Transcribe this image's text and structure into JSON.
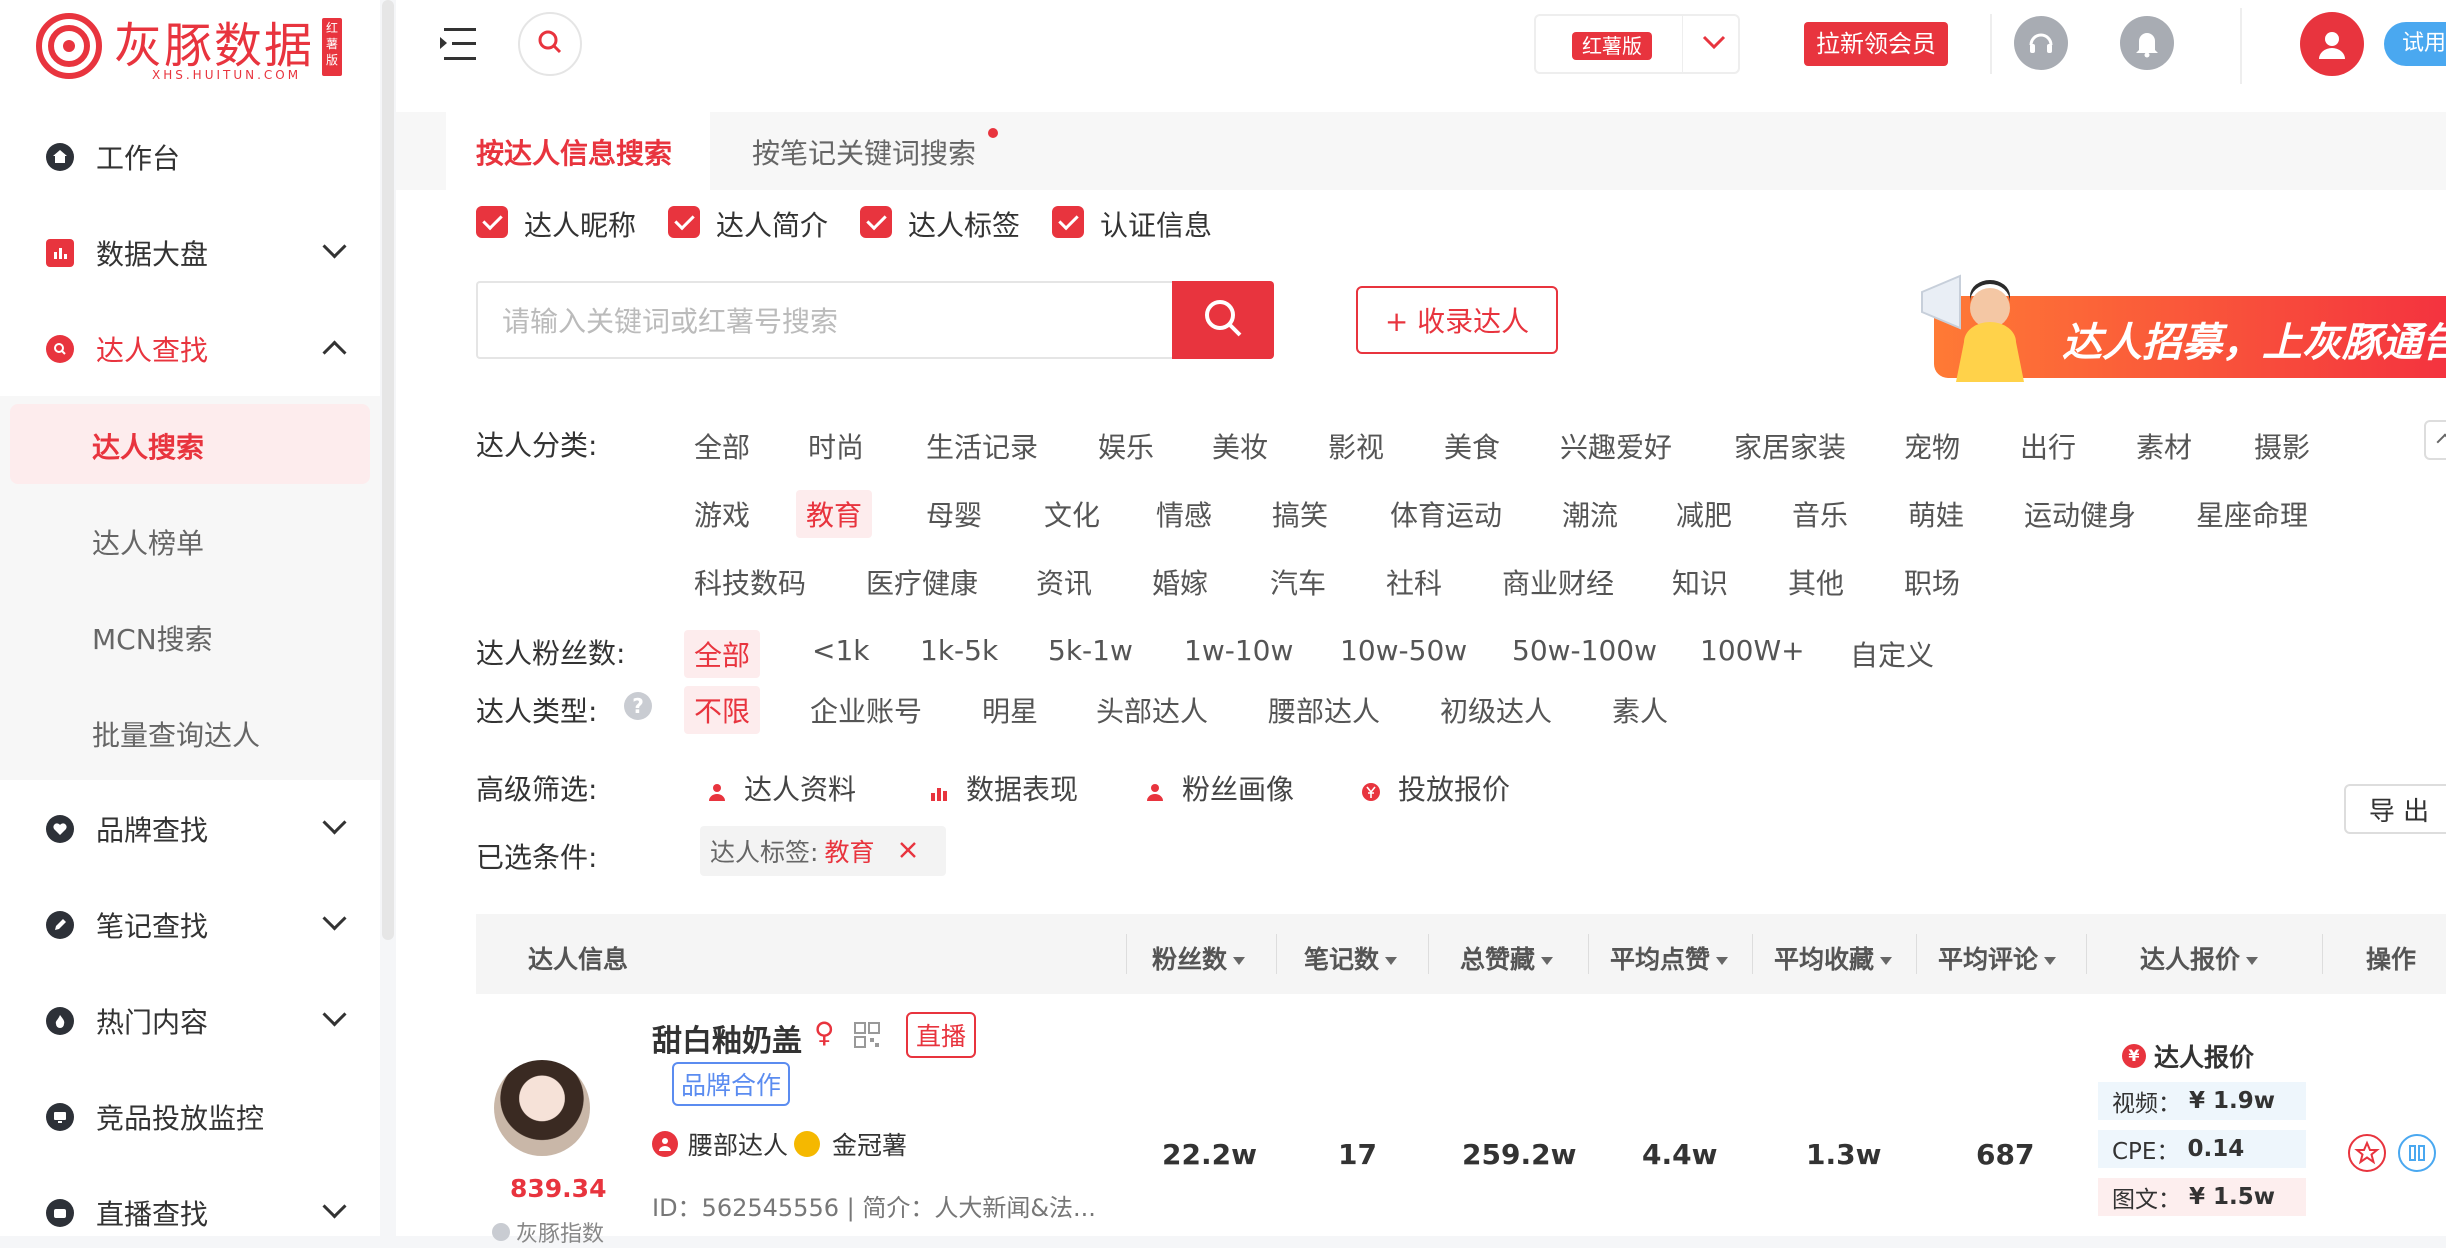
{
  "brand": {
    "name": "灰豚数据",
    "domain_text": "XHS.HUITUN.COM",
    "edition_badge": "红薯版",
    "accent": "#e8343e"
  },
  "sidebar": {
    "items": [
      {
        "label": "工作台",
        "icon": "home-icon"
      },
      {
        "label": "数据大盘",
        "icon": "chart-bars-icon",
        "expandable": true
      },
      {
        "label": "达人查找",
        "icon": "search-circle-icon",
        "expanded": true,
        "children": [
          {
            "label": "达人搜索",
            "active": true
          },
          {
            "label": "达人榜单"
          },
          {
            "label": "MCN搜索"
          },
          {
            "label": "批量查询达人"
          }
        ]
      },
      {
        "label": "品牌查找",
        "icon": "heart-icon",
        "expandable": true
      },
      {
        "label": "笔记查找",
        "icon": "pencil-icon",
        "expandable": true
      },
      {
        "label": "热门内容",
        "icon": "fire-icon",
        "expandable": true
      },
      {
        "label": "竞品投放监控",
        "icon": "monitor-icon"
      },
      {
        "label": "直播查找",
        "icon": "live-icon",
        "expandable": true
      }
    ]
  },
  "header": {
    "version_selector": "红薯版",
    "invite_button": "拉新领会员",
    "trial_button": "试用"
  },
  "tabs": [
    {
      "label": "按达人信息搜索",
      "active": true
    },
    {
      "label": "按笔记关键词搜索",
      "active": false,
      "dot": true
    }
  ],
  "search_fields": [
    "达人昵称",
    "达人简介",
    "达人标签",
    "认证信息"
  ],
  "search": {
    "placeholder": "请输入关键词或红薯号搜索",
    "collect_button": "+ 收录达人"
  },
  "banner": {
    "text": "达人招募，上灰豚通告 →"
  },
  "filters": {
    "category": {
      "label": "达人分类:",
      "selected": "教育",
      "rows": [
        [
          "全部",
          "时尚",
          "生活记录",
          "娱乐",
          "美妆",
          "影视",
          "美食",
          "兴趣爱好",
          "家居家装",
          "宠物",
          "出行",
          "素材",
          "摄影"
        ],
        [
          "游戏",
          "教育",
          "母婴",
          "文化",
          "情感",
          "搞笑",
          "体育运动",
          "潮流",
          "减肥",
          "音乐",
          "萌娃",
          "运动健身",
          "星座命理"
        ],
        [
          "科技数码",
          "医疗健康",
          "资讯",
          "婚嫁",
          "汽车",
          "社科",
          "商业财经",
          "知识",
          "其他",
          "职场"
        ]
      ]
    },
    "fans": {
      "label": "达人粉丝数:",
      "selected": "全部",
      "options": [
        "全部",
        "<1k",
        "1k-5k",
        "5k-1w",
        "1w-10w",
        "10w-50w",
        "50w-100w",
        "100W+",
        "自定义"
      ]
    },
    "type": {
      "label": "达人类型:",
      "selected": "不限",
      "options": [
        "不限",
        "企业账号",
        "明星",
        "头部达人",
        "腰部达人",
        "初级达人",
        "素人"
      ]
    },
    "advanced": {
      "label": "高级筛选:",
      "options": [
        "达人资料",
        "数据表现",
        "粉丝画像",
        "投放报价"
      ]
    },
    "chosen": {
      "label": "已选条件:",
      "tag_key": "达人标签:",
      "tag_value": "教育"
    }
  },
  "export_button": "导 出",
  "table": {
    "columns": [
      "达人信息",
      "粉丝数",
      "笔记数",
      "总赞藏",
      "平均点赞",
      "平均收藏",
      "平均评论",
      "达人报价",
      "操作"
    ],
    "rows": [
      {
        "name": "甜白釉奶盖",
        "gender": "♀",
        "badge_live": "直播",
        "badge_brand": "品牌合作",
        "level": "腰部达人",
        "award": "金冠薯",
        "id_line": "ID：562545556 | 简介：人大新闻&法...",
        "score": "839.34",
        "score_label": "灰豚指数",
        "fans": "22.2w",
        "notes": "17",
        "total_likes": "259.2w",
        "avg_like": "4.4w",
        "avg_collect": "1.3w",
        "avg_comment": "687",
        "price_title": "达人报价",
        "price_video_label": "视频：",
        "price_video": "¥ 1.9w",
        "cpe_label": "CPE：",
        "cpe": "0.14",
        "price_image_label": "图文：",
        "price_image": "¥ 1.5w"
      }
    ]
  }
}
